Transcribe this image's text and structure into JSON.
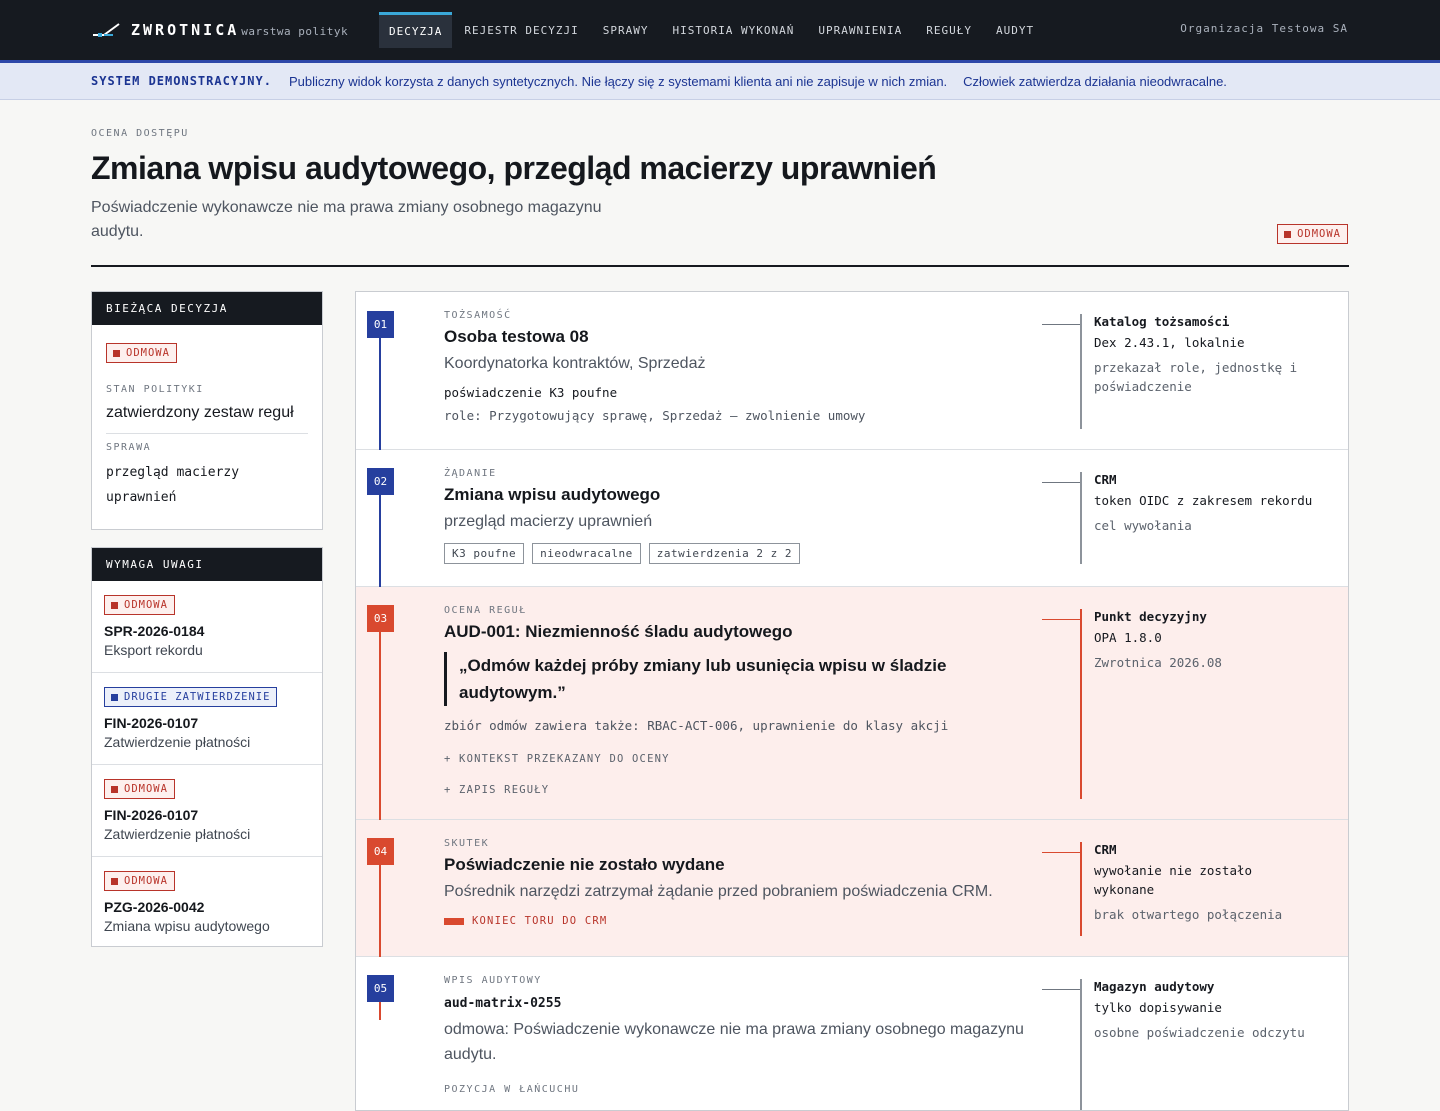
{
  "brand": {
    "name": "ZWROTNICA",
    "sub": "warstwa polityk"
  },
  "nav": {
    "tabs": [
      "DECYZJA",
      "REJESTR DECYZJI",
      "SPRAWY",
      "HISTORIA WYKONAŃ",
      "UPRAWNIENIA",
      "REGUŁY",
      "AUDYT"
    ],
    "active": "DECYZJA",
    "org": "Organizacja Testowa SA"
  },
  "banner": {
    "label": "SYSTEM DEMONSTRACYJNY.",
    "text1": "Publiczny widok korzysta z danych syntetycznych. Nie łączy się z systemami klienta ani nie zapisuje w nich zmian.",
    "text2": "Człowiek zatwierdza działania nieodwracalne."
  },
  "header": {
    "kicker": "OCENA DOSTĘPU",
    "title": "Zmiana wpisu audytowego, przegląd macierzy uprawnień",
    "subtitle": "Poświadczenie wykonawcze nie ma prawa zmiany osobnego magazynu audytu.",
    "badge": "ODMOWA"
  },
  "current": {
    "head": "BIEŻĄCA DECYZJA",
    "badge": "ODMOWA",
    "stan_label": "STAN POLITYKI",
    "stan_value": "zatwierdzony zestaw reguł",
    "sprawa_label": "SPRAWA",
    "sprawa_value": "przegląd macierzy uprawnień"
  },
  "attention": {
    "head": "WYMAGA UWAGI",
    "items": [
      {
        "badge": "ODMOWA",
        "badge_kind": "red",
        "id": "SPR-2026-0184",
        "desc": "Eksport rekordu"
      },
      {
        "badge": "DRUGIE ZATWIERDZENIE",
        "badge_kind": "blue",
        "id": "FIN-2026-0107",
        "desc": "Zatwierdzenie płatności"
      },
      {
        "badge": "ODMOWA",
        "badge_kind": "red",
        "id": "FIN-2026-0107",
        "desc": "Zatwierdzenie płatności"
      },
      {
        "badge": "ODMOWA",
        "badge_kind": "red",
        "id": "PZG-2026-0042",
        "desc": "Zmiana wpisu audytowego"
      }
    ]
  },
  "steps": {
    "s1": {
      "num": "01",
      "label": "TOŻSAMOŚĆ",
      "title": "Osoba testowa 08",
      "sub": "Koordynatorka kontraktów, Sprzedaż",
      "cred": "poświadczenie K3 poufne",
      "roles": "role: Przygotowujący sprawę, Sprzedaż – zwolnienie umowy",
      "side_title": "Katalog tożsamości",
      "side_value": "Dex 2.43.1, lokalnie",
      "side_note": "przekazał role, jednostkę i poświadczenie"
    },
    "s2": {
      "num": "02",
      "label": "ŻĄDANIE",
      "title": "Zmiana wpisu audytowego",
      "sub": "przegląd macierzy uprawnień",
      "tags": [
        "K3 poufne",
        "nieodwracalne",
        "zatwierdzenia 2 z 2"
      ],
      "side_title": "CRM",
      "side_value": "token OIDC z zakresem rekordu",
      "side_note": "cel wywołania"
    },
    "s3": {
      "num": "03",
      "label": "OCENA REGUŁ",
      "title": "AUD-001: Niezmienność śladu audytowego",
      "quote": "„Odmów każdej próby zmiany lub usunięcia wpisu w śladzie audytowym.”",
      "extra": "zbiór odmów zawiera także: RBAC-ACT-006, uprawnienie do klasy akcji",
      "exp1": "+  KONTEKST PRZEKAZANY DO OCENY",
      "exp2": "+  ZAPIS REGUŁY",
      "side_title": "Punkt decyzyjny",
      "side_value": "OPA 1.8.0",
      "side_note": "Zwrotnica 2026.08"
    },
    "s4": {
      "num": "04",
      "label": "SKUTEK",
      "title": "Poświadczenie nie zostało wydane",
      "sub": "Pośrednik narzędzi zatrzymał żądanie przed pobraniem poświadczenia CRM.",
      "endtrack": "KONIEC TORU DO CRM",
      "side_title": "CRM",
      "side_value": "wywołanie nie zostało wykonane",
      "side_note": "brak otwartego połączenia"
    },
    "s5": {
      "num": "05",
      "label": "WPIS AUDYTOWY",
      "title": "aud-matrix-0255",
      "sub": "odmowa: Poświadczenie wykonawcze nie ma prawa zmiany osobnego magazynu audytu.",
      "chain_label": "POZYCJA W ŁAŃCUCHU",
      "side_title": "Magazyn audytowy",
      "side_value": "tylko dopisywanie",
      "side_note": "osobne poświadczenie odczytu"
    }
  },
  "colors": {
    "dark": "#161a20",
    "accent_blue": "#263f9e",
    "accent_red": "#d9492f",
    "tab_highlight": "#3aa8d8"
  }
}
